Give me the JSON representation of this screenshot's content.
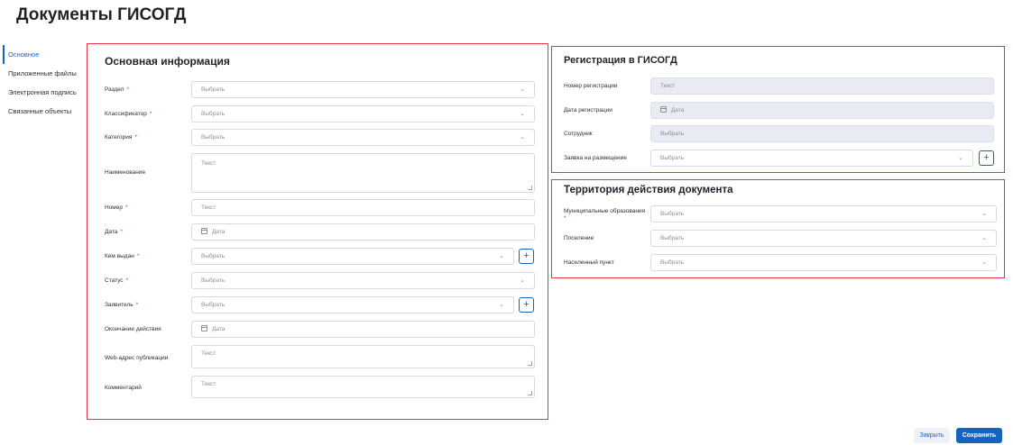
{
  "page": {
    "title": "Документы ГИСОГД"
  },
  "sidebar": {
    "items": [
      {
        "label": "Основное",
        "active": true
      },
      {
        "label": "Приложенные файлы",
        "active": false
      },
      {
        "label": "Электронная подпись",
        "active": false
      },
      {
        "label": "Связанные объекты",
        "active": false
      }
    ]
  },
  "main_info": {
    "title": "Основная информация",
    "fields": {
      "razdel": {
        "label": "Раздел",
        "placeholder": "Выбрать"
      },
      "classifier": {
        "label": "Классификатор",
        "placeholder": "Выбрать"
      },
      "category": {
        "label": "Категория",
        "placeholder": "Выбрать"
      },
      "name": {
        "label": "Наименование",
        "placeholder": "Текст"
      },
      "number": {
        "label": "Номер",
        "placeholder": "Текст"
      },
      "date": {
        "label": "Дата",
        "placeholder": "Дата"
      },
      "issued_by": {
        "label": "Кем выдан",
        "placeholder": "Выбрать"
      },
      "status": {
        "label": "Статус",
        "placeholder": "Выбрать"
      },
      "applicant": {
        "label": "Заявитель",
        "placeholder": "Выбрать"
      },
      "end_date": {
        "label": "Окончание действия",
        "placeholder": "Дата"
      },
      "web_address": {
        "label": "Web-адрес публикации",
        "placeholder": "Текст"
      },
      "comment": {
        "label": "Комментарий",
        "placeholder": "Текст"
      }
    },
    "required_mark": "*"
  },
  "registration": {
    "title": "Регистрация в ГИСОГД",
    "fields": {
      "reg_number": {
        "label": "Номер регистрации",
        "placeholder": "Текст"
      },
      "reg_date": {
        "label": "Дата регистрации",
        "placeholder": "Дата"
      },
      "employee": {
        "label": "Сотрудник",
        "placeholder": "Выбрать"
      },
      "placement_request": {
        "label": "Заявка на размещение",
        "placeholder": "Выбрать"
      }
    }
  },
  "territory": {
    "title": "Территория действия документа",
    "fields": {
      "municipality": {
        "label": "Муниципальные образования",
        "placeholder": "Выбрать"
      },
      "settlement": {
        "label": "Поселение",
        "placeholder": "Выбрать"
      },
      "locality": {
        "label": "Населенный пункт",
        "placeholder": "Выбрать"
      }
    }
  },
  "footer": {
    "close_label": "Закрыть",
    "save_label": "Сохранить"
  },
  "icons": {
    "chevron": "chevron-down-icon",
    "calendar": "calendar-icon",
    "plus": "plus-icon"
  },
  "colors": {
    "accent": "#1565c0",
    "highlight_border": "#e0383e",
    "required": "#e0383e",
    "disabled_field": "#e9ebf3"
  }
}
